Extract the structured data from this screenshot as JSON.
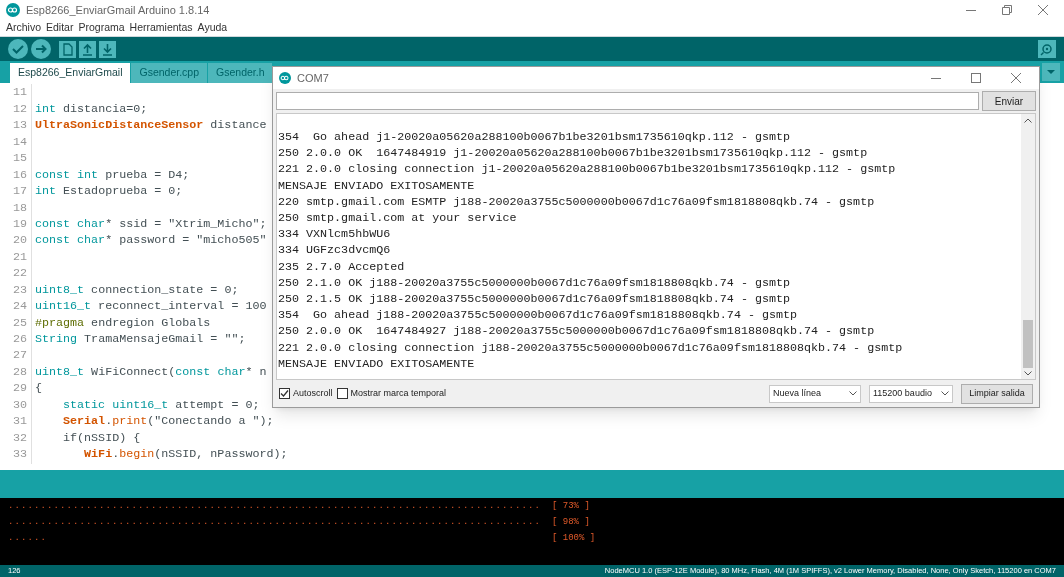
{
  "window": {
    "title": "Esp8266_EnviarGmail Arduino 1.8.14"
  },
  "menu": [
    "Archivo",
    "Editar",
    "Programa",
    "Herramientas",
    "Ayuda"
  ],
  "tabs": [
    {
      "label": "Esp8266_EnviarGmail",
      "selected": true
    },
    {
      "label": "Gsender.cpp",
      "selected": false
    },
    {
      "label": "Gsender.h",
      "selected": false
    }
  ],
  "editor": {
    "lines": [
      {
        "number": "11"
      },
      {
        "number": "12",
        "tokens": [
          {
            "kind": "keyword",
            "text": "int"
          },
          {
            "kind": "plain",
            "text": " distancia=0;"
          }
        ]
      },
      {
        "number": "13",
        "tokens": [
          {
            "kind": "class",
            "text": "UltraSonicDistanceSensor"
          },
          {
            "kind": "plain",
            "text": " distance"
          }
        ]
      },
      {
        "number": "14"
      },
      {
        "number": "15"
      },
      {
        "number": "16",
        "tokens": [
          {
            "kind": "keyword",
            "text": "const int"
          },
          {
            "kind": "plain",
            "text": " prueba = D4;"
          }
        ]
      },
      {
        "number": "17",
        "tokens": [
          {
            "kind": "keyword",
            "text": "int"
          },
          {
            "kind": "plain",
            "text": " Estadoprueba = 0;"
          }
        ]
      },
      {
        "number": "18"
      },
      {
        "number": "19",
        "tokens": [
          {
            "kind": "keyword",
            "text": "const char"
          },
          {
            "kind": "plain",
            "text": "* ssid = \"Xtrim_Micho\";"
          }
        ]
      },
      {
        "number": "20",
        "tokens": [
          {
            "kind": "keyword",
            "text": "const char"
          },
          {
            "kind": "plain",
            "text": "* password = \"micho505\""
          }
        ]
      },
      {
        "number": "21"
      },
      {
        "number": "22"
      },
      {
        "number": "23",
        "tokens": [
          {
            "kind": "keyword",
            "text": "uint8_t"
          },
          {
            "kind": "plain",
            "text": " connection_state = 0;"
          }
        ]
      },
      {
        "number": "24",
        "tokens": [
          {
            "kind": "keyword",
            "text": "uint16_t"
          },
          {
            "kind": "plain",
            "text": " reconnect_interval = 100"
          }
        ]
      },
      {
        "number": "25",
        "tokens": [
          {
            "kind": "preproc",
            "text": "#pragma"
          },
          {
            "kind": "plain",
            "text": " endregion Globals"
          }
        ]
      },
      {
        "number": "26",
        "tokens": [
          {
            "kind": "keyword",
            "text": "String"
          },
          {
            "kind": "plain",
            "text": " TramaMensajeGmail = \"\";"
          }
        ]
      },
      {
        "number": "27"
      },
      {
        "number": "28",
        "tokens": [
          {
            "kind": "keyword",
            "text": "uint8_t"
          },
          {
            "kind": "plain",
            "text": " WiFiConnect("
          },
          {
            "kind": "keyword",
            "text": "const char"
          },
          {
            "kind": "plain",
            "text": "* n"
          }
        ]
      },
      {
        "number": "29",
        "tokens": [
          {
            "kind": "plain",
            "text": "{"
          }
        ]
      },
      {
        "number": "30",
        "tokens": [
          {
            "kind": "keyword",
            "text": "    static uint16_t"
          },
          {
            "kind": "plain",
            "text": " attempt = 0;"
          }
        ]
      },
      {
        "number": "31",
        "tokens": [
          {
            "kind": "class",
            "text": "    Serial"
          },
          {
            "kind": "plain",
            "text": "."
          },
          {
            "kind": "func",
            "text": "print"
          },
          {
            "kind": "plain",
            "text": "(\"Conectando a \");"
          }
        ]
      },
      {
        "number": "32",
        "tokens": [
          {
            "kind": "plain",
            "text": "    if(nSSID) {"
          }
        ]
      },
      {
        "number": "33",
        "tokens": [
          {
            "kind": "class",
            "text": "       WiFi"
          },
          {
            "kind": "plain",
            "text": "."
          },
          {
            "kind": "func",
            "text": "begin"
          },
          {
            "kind": "plain",
            "text": "(nSSID, nPassword);"
          }
        ]
      }
    ]
  },
  "serial_monitor": {
    "title": "COM7",
    "send_button": "Enviar",
    "output": [
      "354  Go ahead j1-20020a05620a288100b0067b1be3201bsm1735610qkp.112 - gsmtp",
      "250 2.0.0 OK  1647484919 j1-20020a05620a288100b0067b1be3201bsm1735610qkp.112 - gsmtp",
      "221 2.0.0 closing connection j1-20020a05620a288100b0067b1be3201bsm1735610qkp.112 - gsmtp",
      "MENSAJE ENVIADO EXITOSAMENTE",
      "220 smtp.gmail.com ESMTP j188-20020a3755c5000000b0067d1c76a09fsm1818808qkb.74 - gsmtp",
      "250 smtp.gmail.com at your service",
      "334 VXNlcm5hbWU6",
      "334 UGFzc3dvcmQ6",
      "235 2.7.0 Accepted",
      "250 2.1.0 OK j188-20020a3755c5000000b0067d1c76a09fsm1818808qkb.74 - gsmtp",
      "250 2.1.5 OK j188-20020a3755c5000000b0067d1c76a09fsm1818808qkb.74 - gsmtp",
      "354  Go ahead j188-20020a3755c5000000b0067d1c76a09fsm1818808qkb.74 - gsmtp",
      "250 2.0.0 OK  1647484927 j188-20020a3755c5000000b0067d1c76a09fsm1818808qkb.74 - gsmtp",
      "221 2.0.0 closing connection j188-20020a3755c5000000b0067d1c76a09fsm1818808qkb.74 - gsmtp",
      "MENSAJE ENVIADO EXITOSAMENTE"
    ],
    "options": [
      {
        "label": "Autoscroll",
        "checked": true
      },
      {
        "label": "Mostrar marca temporal",
        "checked": false
      }
    ],
    "line_ending": "Nueva línea",
    "baud_rate": "115200 baudio",
    "clear_button": "Limpiar salida"
  },
  "console": [
    {
      "progress": "..................................................................................",
      "percent": "[ 73% ]"
    },
    {
      "progress": "..................................................................................",
      "percent": "[ 98% ]"
    },
    {
      "progress": "......",
      "percent": "[ 100% ]"
    }
  ],
  "status_bar": {
    "line": "126",
    "board": "NodeMCU 1.0 (ESP-12E Module), 80 MHz, Flash, 4M (1M SPIFFS), v2 Lower Memory, Disabled, None, Only Sketch, 115200 en COM7"
  }
}
